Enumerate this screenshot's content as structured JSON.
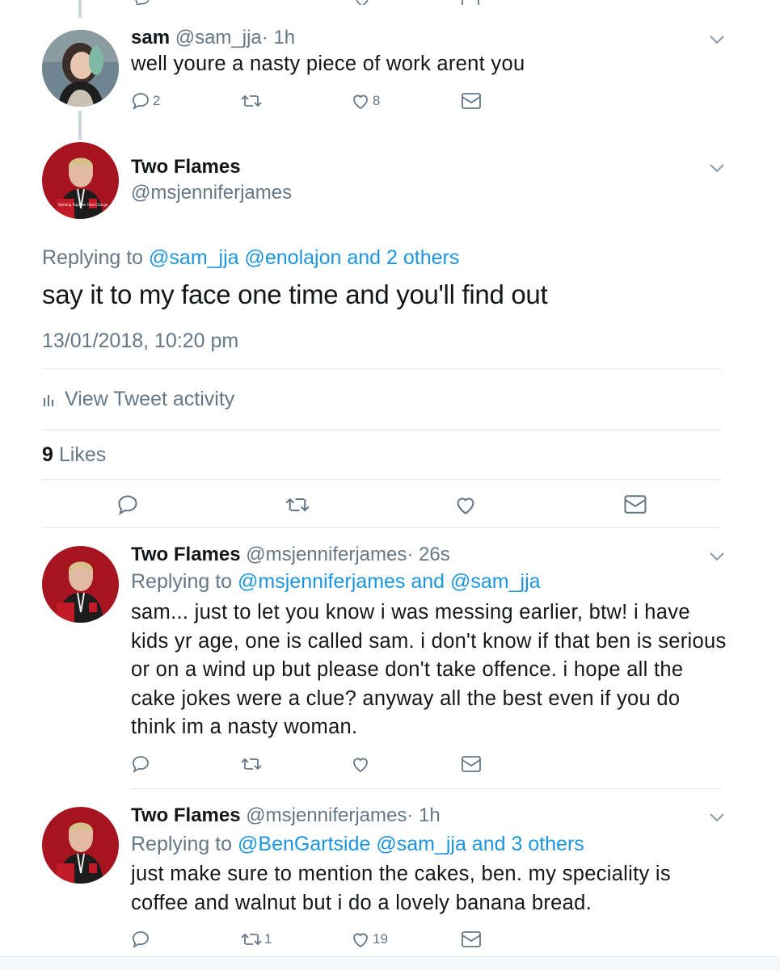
{
  "colors": {
    "accent": "#1b95e0",
    "muted": "#657786",
    "divider": "#e1e8ed",
    "thread": "#ccd6dd"
  },
  "tweets": [
    {
      "name": "sam",
      "handle": "@sam_jja",
      "time": "· 1h",
      "text": "well youre a nasty piece of work arent you",
      "reply_count": "2",
      "retweet_count": "",
      "like_count": "8"
    },
    {
      "name": "Two Flames",
      "handle": "@msjenniferjames",
      "time": "· 26s",
      "replying_prefix": "Replying to",
      "replying_to": "@msjenniferjames and @sam_jja",
      "text": "sam... just to let you know i was messing earlier, btw! i have kids yr age, one is called sam. i don't know if that ben is serious or on a wind up but please don't take offence. i hope all the cake jokes were a clue? anyway all the best even if you do think im a nasty woman.",
      "reply_count": "",
      "retweet_count": "",
      "like_count": ""
    },
    {
      "name": "Two Flames",
      "handle": "@msjenniferjames",
      "time": "· 1h",
      "replying_prefix": "Replying to",
      "replying_to": "@BenGartside @sam_jja and 3 others",
      "text": "just make sure to mention the cakes, ben. my speciality is coffee and walnut but i do a lovely banana bread.",
      "reply_count": "",
      "retweet_count": "1",
      "like_count": "19"
    }
  ],
  "focus": {
    "name": "Two Flames",
    "handle": "@msjenniferjames",
    "replying_prefix": "Replying to",
    "replying_to": "@sam_jja @enolajon and 2 others",
    "text": "say it to my face one time and you'll find out",
    "timestamp": "13/01/2018, 10:20 pm",
    "activity_label": "View Tweet activity",
    "likes_count": "9",
    "likes_label": "Likes"
  },
  "avatar_badge": "Working Together Real Change"
}
